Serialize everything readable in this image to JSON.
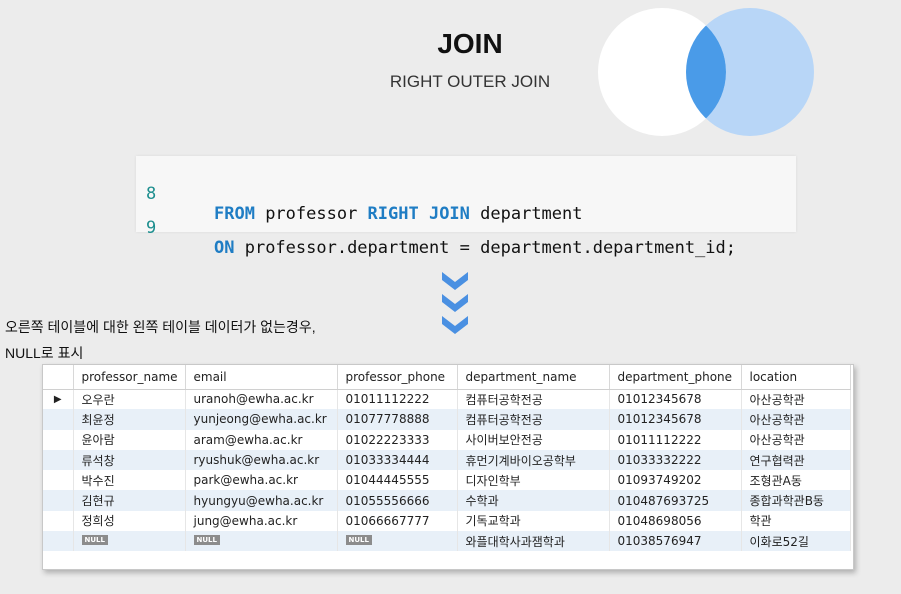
{
  "header": {
    "title": "JOIN",
    "subtitle": "RIGHT OUTER JOIN"
  },
  "colors": {
    "venn_left": "#ffffff",
    "venn_right": "#b8d6f7",
    "venn_overlap": "#4a9be8",
    "chevron": "#4a90e2"
  },
  "code": {
    "lines": [
      {
        "num": "8",
        "tokens": [
          {
            "t": "FROM",
            "k": true
          },
          {
            "t": " professor ",
            "k": false
          },
          {
            "t": "RIGHT JOIN",
            "k": true
          },
          {
            "t": " department",
            "k": false
          }
        ]
      },
      {
        "num": "9",
        "tokens": [
          {
            "t": "ON",
            "k": true
          },
          {
            "t": " professor.department = department.department_id;",
            "k": false
          }
        ]
      }
    ]
  },
  "note": {
    "line1": "오른쪽 테이블에 대한 왼쪽 테이블 데이터가 없는경우,",
    "line2": "NULL로 표시"
  },
  "grid": {
    "columns": [
      "professor_name",
      "email",
      "professor_phone",
      "department_name",
      "department_phone",
      "location"
    ],
    "current_row_marker": "▶",
    "null_label": "NULL",
    "rows": [
      [
        "오우란",
        "uranoh@ewha.ac.kr",
        "01011112222",
        "컴퓨터공학전공",
        "01012345678",
        "아산공학관"
      ],
      [
        "최윤정",
        "yunjeong@ewha.ac.kr",
        "01077778888",
        "컴퓨터공학전공",
        "01012345678",
        "아산공학관"
      ],
      [
        "윤아람",
        "aram@ewha.ac.kr",
        "01022223333",
        "사이버보안전공",
        "01011112222",
        "아산공학관"
      ],
      [
        "류석창",
        "ryushuk@ewha.ac.kr",
        "01033334444",
        "휴먼기계바이오공학부",
        "01033332222",
        "연구협력관"
      ],
      [
        "박수진",
        "park@ewha.ac.kr",
        "01044445555",
        "디자인학부",
        "01093749202",
        "조형관A동"
      ],
      [
        "김현규",
        "hyungyu@ewha.ac.kr",
        "01055556666",
        "수학과",
        "010487693725",
        "종합과학관B동"
      ],
      [
        "정희성",
        "jung@ewha.ac.kr",
        "01066667777",
        "기독교학과",
        "01048698056",
        "학관"
      ],
      [
        null,
        null,
        null,
        "와플대학사과잼학과",
        "01038576947",
        "이화로52길"
      ]
    ]
  }
}
